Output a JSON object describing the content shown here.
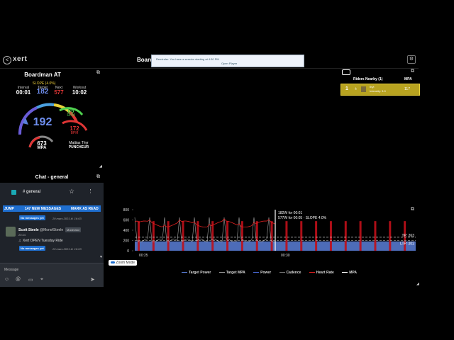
{
  "app": {
    "back_label": "<",
    "logo": "xert",
    "board_title": "Board"
  },
  "notification": {
    "line1": "Reminder: You have a session starting at 4:30 PM",
    "link": "Open Player"
  },
  "workout": {
    "rider": "Boardman AT",
    "slope": "SLOPE (4.0%)",
    "interval_label": "Interval",
    "interval": "00:01",
    "target_label": "Target",
    "target": "182",
    "next_label": "Next",
    "next": "577",
    "workout_label": "Workout",
    "workout_time": "10:02",
    "power": "192",
    "cadence": "85",
    "cadence_unit": "RPM",
    "heart_rate": "172",
    "hr_unit": "BPM",
    "mpa": "673",
    "mpa_unit": "MPA",
    "athlete": "Mattias Thyr",
    "athlete_type": "PUNCHEUR"
  },
  "chat": {
    "title": "Chat - general",
    "channel": "# general",
    "jump": "JUMP",
    "new_messages": "147 NEW MESSAGES",
    "mark_read": "MARK AS READ",
    "no_messages": "No messages yet",
    "ts1": "20 mars 2021 kl. 16:03",
    "author": "Scott Steele",
    "handle": "@MonofSteele",
    "role": "Moderator",
    "msg_time": "20:44",
    "message": "Xert OPEN Tuesday Ride",
    "ts2": "20 mars 2021 kl. 16:03",
    "composer_placeholder": "Message"
  },
  "riders": {
    "title": "Riders Nearby (1)",
    "col_mpa": "MPA",
    "rank": "1",
    "name": "thyt",
    "intensity": "Intensity: 3.0",
    "mpa": "117"
  },
  "chart": {
    "tooltip1": "182W for 00:01",
    "tooltip2": "577W for 00:05 · SLOPE 4.0%",
    "tp_label": "TP: 263",
    "ltp_label": "LTP: 202",
    "zoom_label": "Zoom Mode",
    "legend": [
      "Target Power",
      "Target MPA",
      "Power",
      "Cadence",
      "Heart Rate",
      "MPA"
    ]
  },
  "chart_data": {
    "type": "line",
    "y_ticks": [
      "0",
      "200",
      "400",
      "600",
      "800"
    ],
    "x_ticks": [
      "00:25",
      "00:30"
    ],
    "ylim": [
      0,
      800
    ],
    "tp": 263,
    "ltp": 202,
    "target_power_pattern": {
      "base": 182,
      "peak": 577,
      "intervals": 19
    },
    "colors": {
      "target": "#5a7fd8",
      "interval": "#c0101a",
      "hr": "#e02020",
      "power": "#e8e8e8",
      "mpa": "#ffffff"
    }
  }
}
